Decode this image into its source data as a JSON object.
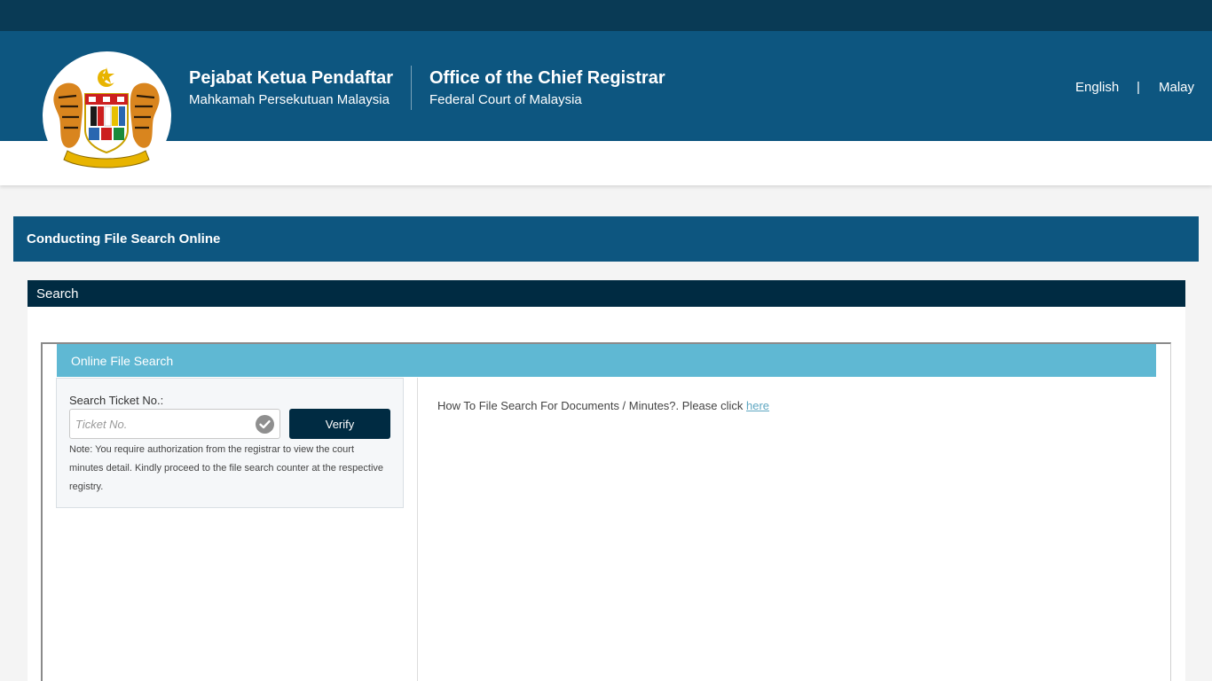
{
  "header": {
    "title_malay": "Pejabat Ketua Pendaftar",
    "subtitle_malay": "Mahkamah Persekutuan Malaysia",
    "title_english": "Office of the Chief Registrar",
    "subtitle_english": "Federal Court of Malaysia",
    "logo_icon": "malaysia-coat-of-arms-icon"
  },
  "lang": {
    "english": "English",
    "separator": "|",
    "malay": "Malay"
  },
  "page_title": "Conducting File Search Online",
  "panel": {
    "title": "Search",
    "inner_title": "Online File Search"
  },
  "search": {
    "label": "Search Ticket No.:",
    "value": "",
    "placeholder": "Ticket No.",
    "check_icon": "check-circle-icon",
    "verify_label": "Verify",
    "note": "Note: You require authorization from the registrar to view the court minutes detail. Kindly proceed to the file search counter at the respective registry."
  },
  "howto": {
    "text": "How To File Search For Documents / Minutes?. Please click ",
    "link": "here"
  },
  "colors": {
    "topbar": "#093a55",
    "header": "#0d5680",
    "panel_head": "#002b42",
    "inner_head": "#5fb8d3",
    "link": "#5fa7c2"
  }
}
